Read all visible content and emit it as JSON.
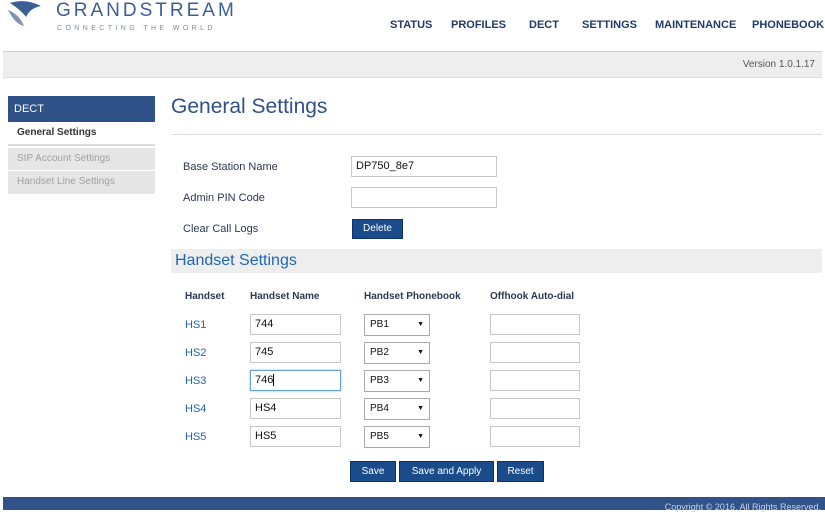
{
  "brand": {
    "name": "GRANDSTREAM",
    "tagline": "CONNECTING THE WORLD",
    "accent": "#2f5289"
  },
  "nav": {
    "items": [
      "STATUS",
      "PROFILES",
      "DECT",
      "SETTINGS",
      "MAINTENANCE",
      "PHONEBOOK"
    ]
  },
  "version": "Version 1.0.1.17",
  "sidebar": {
    "header": "DECT",
    "items": [
      {
        "label": "General Settings",
        "active": true
      },
      {
        "label": "SIP Account Settings",
        "active": false
      },
      {
        "label": "Handset Line Settings",
        "active": false
      }
    ]
  },
  "main": {
    "title": "General Settings",
    "general": {
      "base_station_label": "Base Station Name",
      "base_station_value": "DP750_8e7",
      "admin_pin_label": "Admin PIN Code",
      "admin_pin_value": "",
      "clear_logs_label": "Clear Call Logs",
      "delete_label": "Delete"
    },
    "handset_section": {
      "title": "Handset Settings",
      "columns": [
        "Handset",
        "Handset Name",
        "Handset Phonebook",
        "Offhook Auto-dial"
      ],
      "rows": [
        {
          "id": "HS1",
          "name": "744",
          "phonebook": "PB1",
          "autodial": ""
        },
        {
          "id": "HS2",
          "name": "745",
          "phonebook": "PB2",
          "autodial": ""
        },
        {
          "id": "HS3",
          "name": "746",
          "phonebook": "PB3",
          "autodial": ""
        },
        {
          "id": "HS4",
          "name": "HS4",
          "phonebook": "PB4",
          "autodial": ""
        },
        {
          "id": "HS5",
          "name": "HS5",
          "phonebook": "PB5",
          "autodial": ""
        }
      ]
    },
    "buttons": {
      "save": "Save",
      "save_apply": "Save and Apply",
      "reset": "Reset"
    }
  },
  "footer": {
    "copyright": "Copyright © 2016. All Rights Reserved."
  }
}
